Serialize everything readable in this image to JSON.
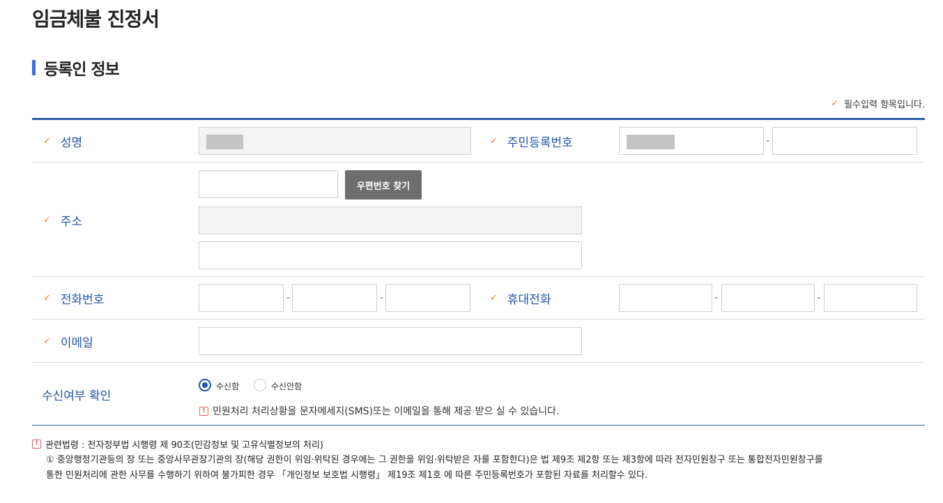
{
  "page": {
    "title": "임금체불 진정서",
    "section_title": "등록인 정보",
    "required_note": "필수입력 항목입니다.",
    "check_mark": "✓"
  },
  "fields": {
    "name": {
      "label": "성명"
    },
    "rrn": {
      "label": "주민등록번호"
    },
    "address": {
      "label": "주소",
      "zip_button": "우편번호 찾기"
    },
    "phone": {
      "label": "전화번호"
    },
    "mobile": {
      "label": "휴대전화"
    },
    "email": {
      "label": "이메일"
    },
    "receive": {
      "label": "수신여부 확인",
      "options": [
        {
          "label": "수신함",
          "selected": true
        },
        {
          "label": "수신안함",
          "selected": false
        }
      ],
      "note": "민원처리 처리상황을 문자메세지(SMS)또는 이메일을 통해 제공 받으 실 수 있습니다."
    }
  },
  "law": {
    "title": "관련법령 : 전자정부법 시행령 제 90조(민감정보 및 고유식별정보의 처리)",
    "line1": "① 중앙행정기관등의 장 또는 중앙사무관장기관의 장(해당 권한이 위임·위탁된 경우에는 그 권한을 위임·위탁받은 자를 포함한다)은 법 제9조 제2항 또는 제3항에 따라 전자민원창구 또는 통합전자민원창구를",
    "line2": "통한 민원처리에 관한 사무를 수행하기 위하여 불가피한 경우 「개인정보 보호법 시행령」 제19조 제1호 에 따른 주민등록번호가 포함된 자료를 처리할수 있다."
  },
  "colors": {
    "accent": "#2054a8",
    "table_border": "#2e5fa8",
    "check": "#e8772e",
    "button_bg": "#6e6e70",
    "section_bar": "#3b6fd8"
  },
  "icons": {
    "required": "check-icon",
    "warning": "exclamation-box-icon"
  }
}
